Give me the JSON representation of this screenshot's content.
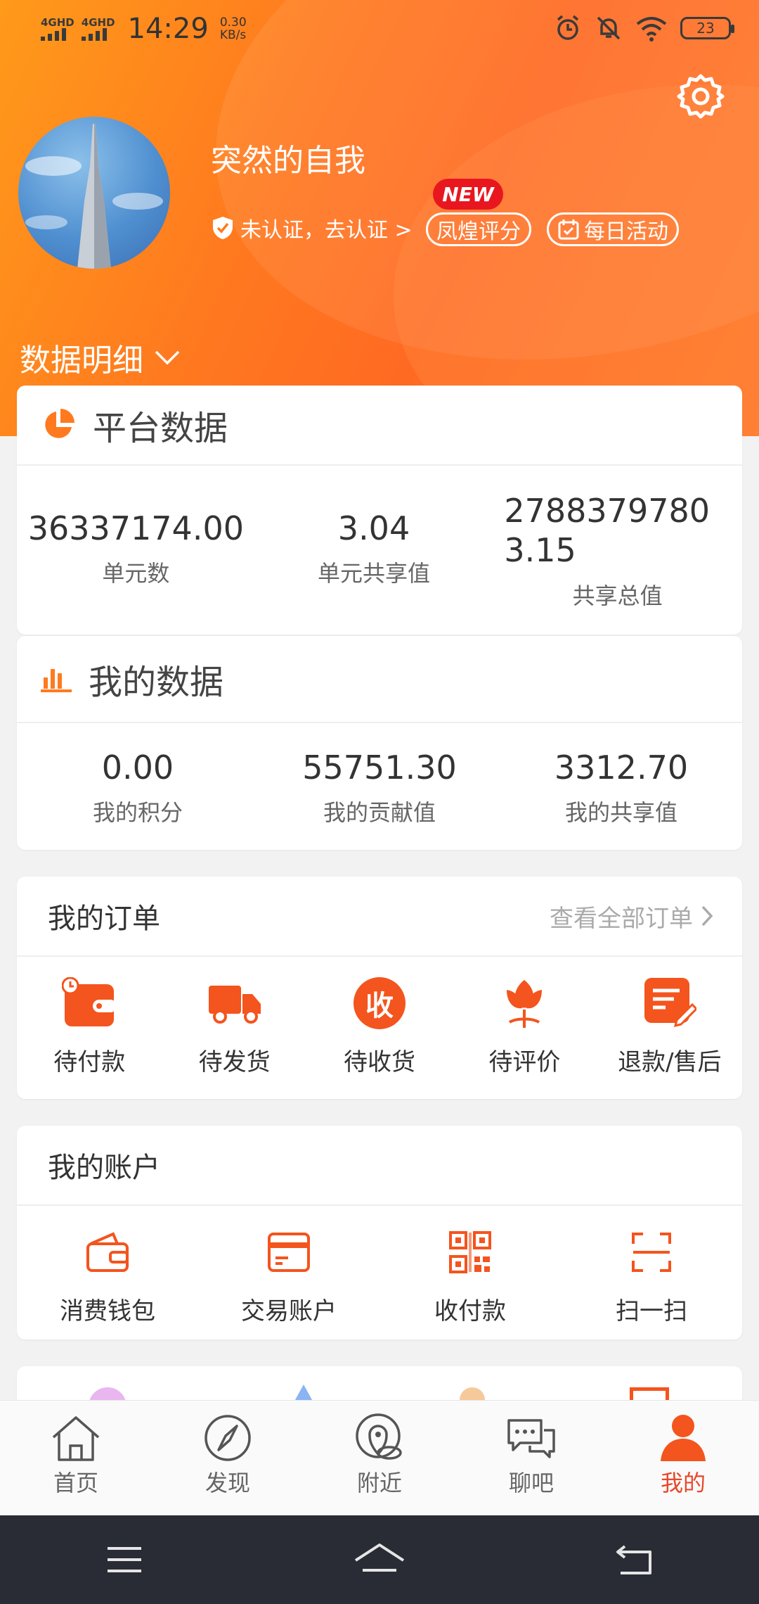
{
  "status_bar": {
    "network1": "4GHD",
    "network2": "4GHD",
    "time": "14:29",
    "speed_value": "0.30",
    "speed_unit": "KB/s",
    "battery": "23"
  },
  "profile": {
    "username": "突然的自我",
    "verify_text": "未认证，去认证 >",
    "new_badge": "NEW",
    "score_label": "凤煌评分",
    "daily_label": "每日活动",
    "detail_toggle": "数据明细"
  },
  "platform": {
    "title": "平台数据",
    "stats": [
      {
        "value": "36337174.00",
        "label": "单元数"
      },
      {
        "value": "3.04",
        "label": "单元共享值"
      },
      {
        "value": "27883797803.15",
        "label": "共享总值"
      }
    ]
  },
  "mine": {
    "title": "我的数据",
    "stats": [
      {
        "value": "0.00",
        "label": "我的积分"
      },
      {
        "value": "55751.30",
        "label": "我的贡献值"
      },
      {
        "value": "3312.70",
        "label": "我的共享值"
      }
    ]
  },
  "orders": {
    "title": "我的订单",
    "view_all": "查看全部订单",
    "items": [
      {
        "label": "待付款",
        "icon": "wallet-clock-icon"
      },
      {
        "label": "待发货",
        "icon": "truck-icon"
      },
      {
        "label": "待收货",
        "icon": "receive-icon",
        "glyph": "收"
      },
      {
        "label": "待评价",
        "icon": "flower-icon"
      },
      {
        "label": "退款/售后",
        "icon": "edit-note-icon"
      }
    ]
  },
  "account": {
    "title": "我的账户",
    "items": [
      {
        "label": "消费钱包",
        "icon": "wallet-icon"
      },
      {
        "label": "交易账户",
        "icon": "card-icon"
      },
      {
        "label": "收付款",
        "icon": "qrcode-icon"
      },
      {
        "label": "扫一扫",
        "icon": "scan-icon"
      }
    ]
  },
  "tabs": [
    {
      "label": "首页",
      "icon": "home-icon"
    },
    {
      "label": "发现",
      "icon": "compass-icon"
    },
    {
      "label": "附近",
      "icon": "location-icon"
    },
    {
      "label": "聊吧",
      "icon": "chat-icon"
    },
    {
      "label": "我的",
      "icon": "user-icon",
      "active": true
    }
  ],
  "colors": {
    "accent": "#ff6a22",
    "active_tab": "#e8482a",
    "new_badge": "#e8171f"
  }
}
